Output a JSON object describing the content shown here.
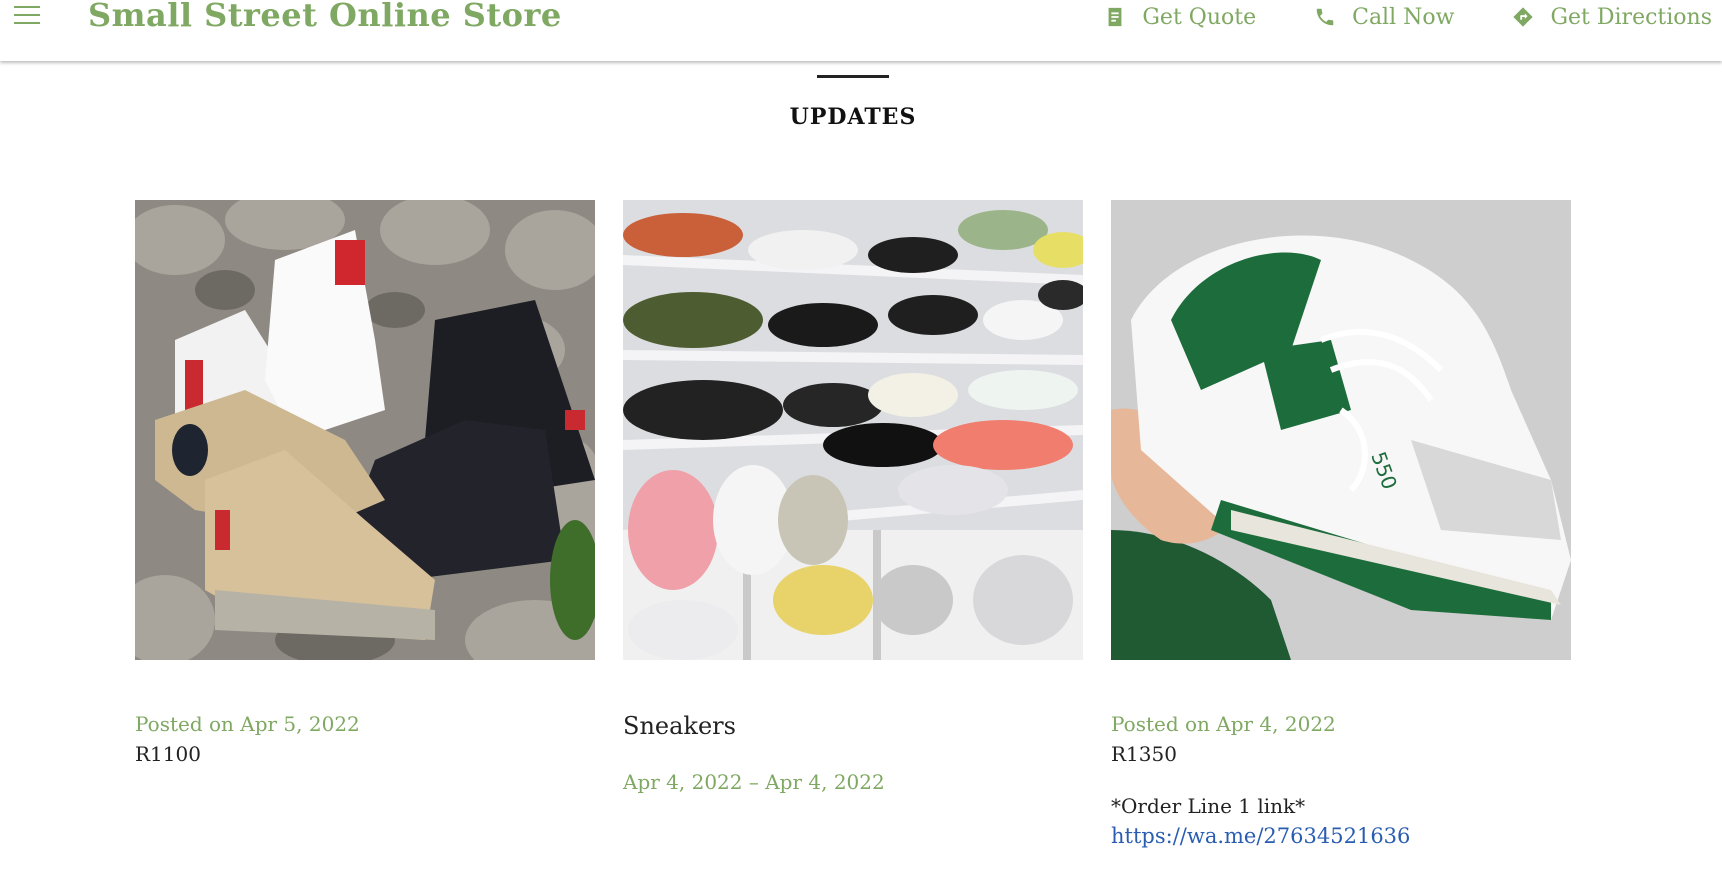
{
  "header": {
    "brand": "Small Street Online Store",
    "menu_icon": "hamburger-menu-icon",
    "nav": [
      {
        "label": "Get Quote",
        "icon": "document-icon"
      },
      {
        "label": "Call Now",
        "icon": "phone-icon"
      },
      {
        "label": "Get Directions",
        "icon": "directions-icon"
      }
    ],
    "brand_color": "#7fa862"
  },
  "section": {
    "title": "UPDATES"
  },
  "cards": [
    {
      "image_desc": "canvas high-top boots on rocks",
      "posted": "Posted on Apr 5, 2022",
      "price": "R1100"
    },
    {
      "image_desc": "sneaker shelves in store",
      "title": "Sneakers",
      "daterange": "Apr 4, 2022 – Apr 4, 2022"
    },
    {
      "image_desc": "white and green sneaker held in hand",
      "posted": "Posted on Apr 4, 2022",
      "price": "R1350",
      "order_text": "*Order Line 1 link*",
      "order_link": "https://wa.me/27634521636"
    }
  ]
}
